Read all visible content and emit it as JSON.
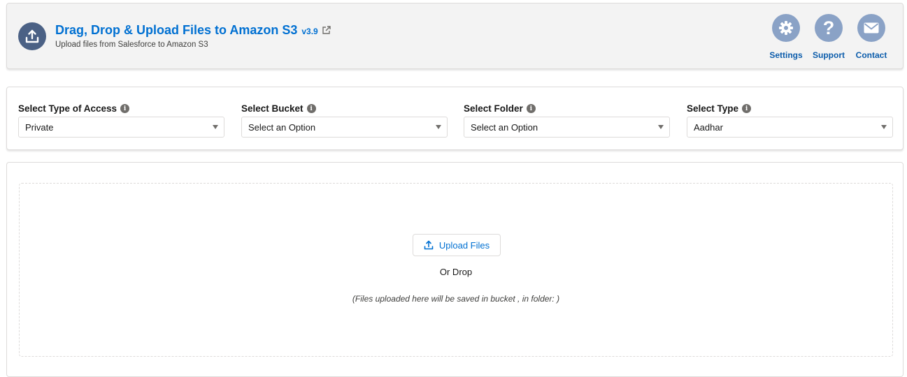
{
  "header": {
    "title": "Drag, Drop & Upload Files to Amazon S3",
    "version": "v3.9",
    "subtitle": "Upload files from Salesforce to Amazon S3",
    "icons": {
      "app": "upload-icon",
      "external": "external-link-icon"
    },
    "buttons": [
      {
        "label": "Settings",
        "icon": "gear-icon"
      },
      {
        "label": "Support",
        "icon": "question-icon"
      },
      {
        "label": "Contact",
        "icon": "mail-icon"
      }
    ]
  },
  "filters": [
    {
      "label": "Select Type of Access",
      "value": "Private"
    },
    {
      "label": "Select Bucket",
      "value": "Select an Option"
    },
    {
      "label": "Select Folder",
      "value": "Select an Option"
    },
    {
      "label": "Select Type",
      "value": "Aadhar"
    }
  ],
  "upload": {
    "button_label": "Upload Files",
    "or_drop": "Or Drop",
    "note": "(Files uploaded here will be saved in bucket , in folder: )"
  },
  "colors": {
    "brand_blue": "#0070d2",
    "app_icon_bg": "#4b6185",
    "action_icon_bg": "#8aa2c6",
    "header_bg": "#f3f3f3"
  }
}
